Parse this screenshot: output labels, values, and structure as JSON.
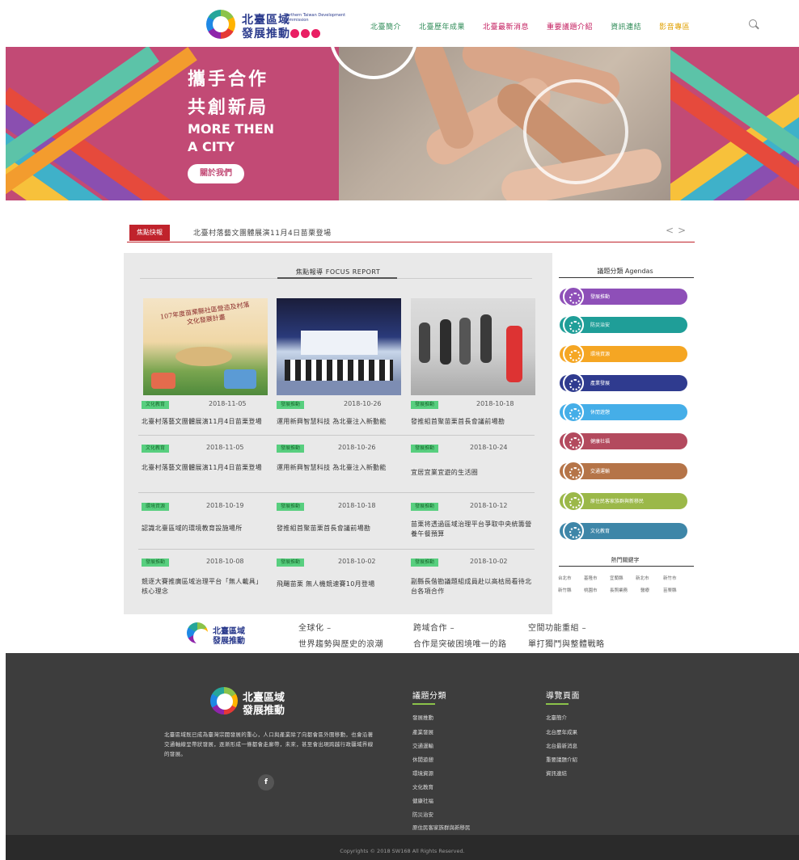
{
  "header": {
    "logo_title_1": "北臺區域",
    "logo_title_2": "發展推動",
    "logo_en": "Northern Taiwan Development Commission",
    "nav": [
      {
        "label": "北臺簡介",
        "color": "#2e8b57"
      },
      {
        "label": "北臺歷年成果",
        "color": "#2e8b57"
      },
      {
        "label": "北臺最新消息",
        "color": "#c2185b"
      },
      {
        "label": "重要議題介紹",
        "color": "#c2185b"
      },
      {
        "label": "資訊連結",
        "color": "#2e8b57"
      },
      {
        "label": "影音專區",
        "color": "#e0a000"
      }
    ]
  },
  "hero": {
    "title_1": "攜手合作",
    "title_2": "共創新局",
    "en_1": "MORE THEN",
    "en_2": "A CITY",
    "button": "關於我們"
  },
  "ticker": {
    "label": "焦點快報",
    "text": "北臺村落藝文團體展演11月4日苗栗登場",
    "prev": "<",
    "next": ">"
  },
  "focus": {
    "title": "焦點報導 FOCUS REPORT",
    "cards": [
      {
        "tag": "文化教育",
        "date": "2018-11-05",
        "headline": "北臺村落藝文團體展演11月4日苗栗登場",
        "img_text": "107年度苗栗縣社區營造及村落文化發展計畫"
      },
      {
        "tag": "發展推動",
        "date": "2018-10-26",
        "headline": "運用新興智慧科技 為北臺注入新動能",
        "img_text": ""
      },
      {
        "tag": "發展推動",
        "date": "2018-10-18",
        "headline": "發推組首聚苗栗首長會議前場勘",
        "img_text": ""
      }
    ],
    "rows": [
      [
        {
          "tag": "文化教育",
          "date": "2018-11-05",
          "headline": "北臺村落藝文團體展演11月4日苗栗登場"
        },
        {
          "tag": "發展推動",
          "date": "2018-10-26",
          "headline": "運用新興智慧科技 為北臺注入新動能"
        },
        {
          "tag": "發展推動",
          "date": "2018-10-24",
          "headline": "宜居宜業宜遊的生活圈"
        }
      ],
      [
        {
          "tag": "環境資源",
          "date": "2018-10-19",
          "headline": "認識北臺區域的環境教育設施場所"
        },
        {
          "tag": "發展推動",
          "date": "2018-10-18",
          "headline": "發推組首聚苗栗首長會議前場勘"
        },
        {
          "tag": "發展推動",
          "date": "2018-10-12",
          "headline": "苗栗将透過區域治理平台爭取中央統籌營養午餐預算"
        }
      ],
      [
        {
          "tag": "發展推動",
          "date": "2018-10-08",
          "headline": "競逐大賽推廣區域治理平台「無人載具」核心理念"
        },
        {
          "tag": "發展推動",
          "date": "2018-10-02",
          "headline": "飛颺苗栗 無人機競速賽10月登場"
        },
        {
          "tag": "發展推動",
          "date": "2018-10-02",
          "headline": "副縣長偕勘議題組成員赴以高枯局看待北台各項合作"
        }
      ]
    ]
  },
  "agendas": {
    "title": "議題分類 Agendas",
    "items": [
      {
        "label": "發展推動",
        "color": "#8e4fb8"
      },
      {
        "label": "防災治安",
        "color": "#1f9e98"
      },
      {
        "label": "環境資源",
        "color": "#f5a623"
      },
      {
        "label": "產業發展",
        "color": "#2f3b8f"
      },
      {
        "label": "休閒遊憩",
        "color": "#45aee8"
      },
      {
        "label": "健康社福",
        "color": "#b34a5e"
      },
      {
        "label": "交通運輸",
        "color": "#b57448"
      },
      {
        "label": "原住民客家族群與新移民",
        "color": "#9bb849"
      },
      {
        "label": "文化教育",
        "color": "#3e86a8"
      }
    ],
    "keywords_title": "熱門關鍵字",
    "keywords": [
      "台北市",
      "基隆市",
      "宜蘭縣",
      "新北市",
      "新竹市",
      "新竹縣",
      "桃園市",
      "長照業務",
      "醫療",
      "苗栗縣"
    ]
  },
  "strip": {
    "items": [
      {
        "line1": "全球化 –",
        "line2": "世界趨勢與歷史的浪潮"
      },
      {
        "line1": "跨域合作 –",
        "line2": "合作是突破困境唯一的路"
      },
      {
        "line1": "空間功能重組 –",
        "line2": "單打獨鬥與整體戰略"
      }
    ]
  },
  "footer": {
    "desc": "北臺區域既已成為臺灣宗閥發展的重心，人口與產業除了向都會區外圍移動，也會沿著交通軸線呈帶狀發展，逐漸形成一條都會走廊帶，未來，甚至會出現跨越行政疆域界線的發展。",
    "fb": "f",
    "col1_title": "議題分類",
    "col1": [
      "發展推動",
      "產業發展",
      "交通運輸",
      "休閒遊憩",
      "環境資源",
      "文化教育",
      "健康社福",
      "防災治安",
      "原住民客家族群與新移民"
    ],
    "col2_title": "導覽頁面",
    "col2": [
      "北臺簡介",
      "北台歷年成果",
      "北台最新消息",
      "重要議題介紹",
      "資訊連結"
    ],
    "copyright": "Copyrights © 2018 SW168 All Rights Reserved."
  }
}
